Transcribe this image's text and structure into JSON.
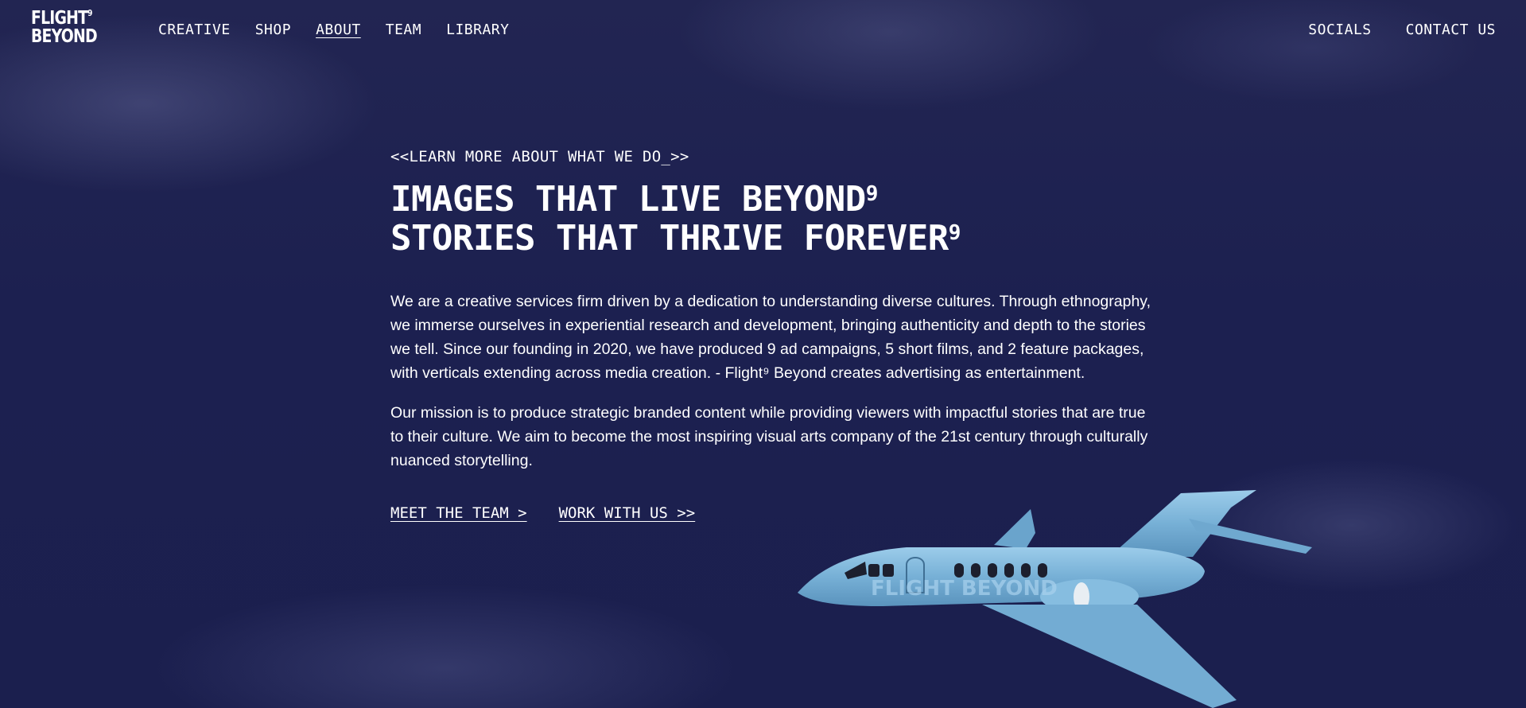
{
  "brand": {
    "logo_line1": "FLIGHT",
    "logo_sup": "9",
    "logo_line2": "BEYOND"
  },
  "nav": {
    "items": [
      {
        "label": "CREATIVE"
      },
      {
        "label": "SHOP"
      },
      {
        "label": "ABOUT",
        "active": true
      },
      {
        "label": "TEAM"
      },
      {
        "label": "LIBRARY"
      }
    ],
    "right": [
      {
        "label": "SOCIALS"
      },
      {
        "label": "CONTACT US"
      }
    ]
  },
  "hero": {
    "eyebrow": "<<LEARN MORE ABOUT WHAT WE DO_>>",
    "headline_line1": "IMAGES THAT LIVE BEYOND",
    "headline_line1_sup": "9",
    "headline_line2": "STORIES THAT THRIVE FOREVER",
    "headline_line2_sup": "9",
    "paragraph1": "We are a creative services firm driven by a dedication to understanding diverse cultures. Through ethnography, we immerse ourselves in experiential research and development, bringing authenticity and depth to the stories we tell. Since our founding in 2020, we have produced 9 ad campaigns, 5 short films, and 2 feature packages, with verticals extending across media creation. - Flight⁹ Beyond creates advertising as entertainment.",
    "paragraph2": "Our mission is to produce strategic branded content while providing viewers with impactful stories that are true to their culture. We aim to become the most inspiring visual arts company of the 21st century through culturally nuanced storytelling.",
    "cta_team": "MEET THE TEAM >",
    "cta_work": "WORK WITH US >>"
  },
  "jet": {
    "livery_text": "FLIGHT BEYOND"
  },
  "colors": {
    "background": "#1c2050",
    "text": "#ffffff",
    "jet_body": "#7fb6db"
  },
  "icons": [
    "jet-illustration"
  ]
}
